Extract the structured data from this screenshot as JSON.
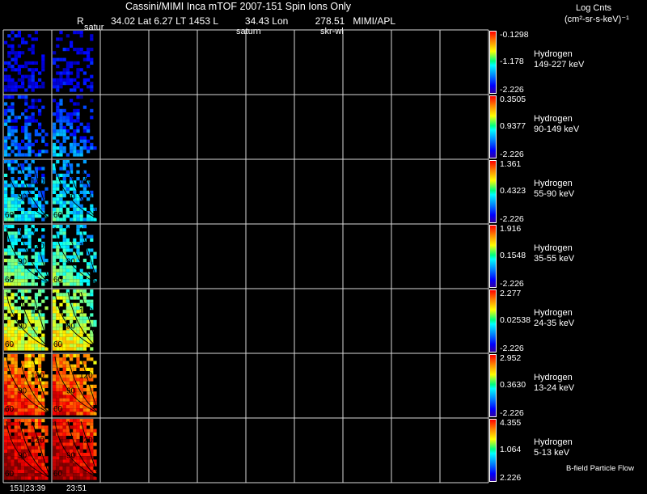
{
  "header": {
    "title": "Cassini/MIMI Inca mTOF  2007-151   Spin    Ions Only",
    "info": "R          34.02 Lat 6.27 LT 1453 L          34.43 Lon          278.51   MIMI/APL",
    "units_line1": "Log Cnts",
    "units_line2": "(cm²-sr-s-keV)⁻¹"
  },
  "overlay_labels": {
    "satur": "satur",
    "saturn": "saturn",
    "skr": "skr-wl"
  },
  "footer": {
    "time1": "151|23:39",
    "time2": "23:51",
    "bfield": "B-field Particle Flow"
  },
  "chart_data": {
    "type": "heatmap",
    "title": "Cassini/MIMI Inca mTOF  2007-151   Spin    Ions Only",
    "colorbar_label": "Log Cnts (cm²-sr-s-keV)⁻¹",
    "columns_with_data": 2,
    "total_columns": 10,
    "pitch_angle_contours": [
      "60",
      "90",
      "120"
    ],
    "x_tick_labels": [
      "151|23:39",
      "23:51"
    ],
    "panels": [
      {
        "species": "Hydrogen",
        "energy": "149-227 keV",
        "cbar_max": "-0.1298",
        "cbar_mid": "-1.178",
        "cbar_min": "-2.226",
        "level": 0.05
      },
      {
        "species": "Hydrogen",
        "energy": "90-149 keV",
        "cbar_max": "0.3505",
        "cbar_mid": "0.9377",
        "cbar_min": "-2.226",
        "level": 0.18
      },
      {
        "species": "Hydrogen",
        "energy": "55-90 keV",
        "cbar_max": "1.361",
        "cbar_mid": "0.4323",
        "cbar_min": "-2.226",
        "level": 0.3
      },
      {
        "species": "Hydrogen",
        "energy": "35-55 keV",
        "cbar_max": "1.916",
        "cbar_mid": "0.1548",
        "cbar_min": "-2.226",
        "level": 0.4
      },
      {
        "species": "Hydrogen",
        "energy": "24-35 keV",
        "cbar_max": "2.277",
        "cbar_mid": "0.02538",
        "cbar_min": "-2.226",
        "level": 0.55
      },
      {
        "species": "Hydrogen",
        "energy": "13-24 keV",
        "cbar_max": "2.952",
        "cbar_mid": "0.3630",
        "cbar_min": "-2.226",
        "level": 0.78
      },
      {
        "species": "Hydrogen",
        "energy": "5-13 keV",
        "cbar_max": "4.355",
        "cbar_mid": "1.064",
        "cbar_min": "2.226",
        "level": 0.9
      }
    ]
  }
}
